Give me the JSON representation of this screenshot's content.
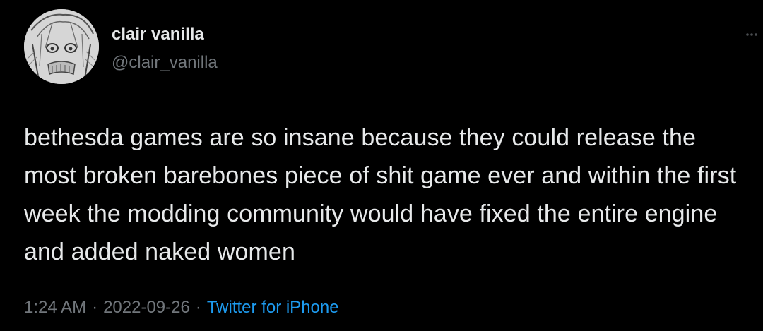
{
  "tweet": {
    "author": {
      "display_name": "clair vanilla",
      "handle": "@clair_vanilla",
      "avatar_icon": "anime-girl-sketch-avatar"
    },
    "more_icon": "ellipsis-icon",
    "text": "bethesda games are so insane because they could release the most broken barebones piece of shit game ever and within the first week the modding community would have fixed the entire engine and added naked women",
    "meta": {
      "time": "1:24 AM",
      "separator": "·",
      "date": "2022-09-26",
      "source": "Twitter for iPhone"
    }
  },
  "colors": {
    "background": "#000000",
    "primary_text": "#e7e9ea",
    "secondary_text": "#71767b",
    "link": "#1d9bf0"
  }
}
